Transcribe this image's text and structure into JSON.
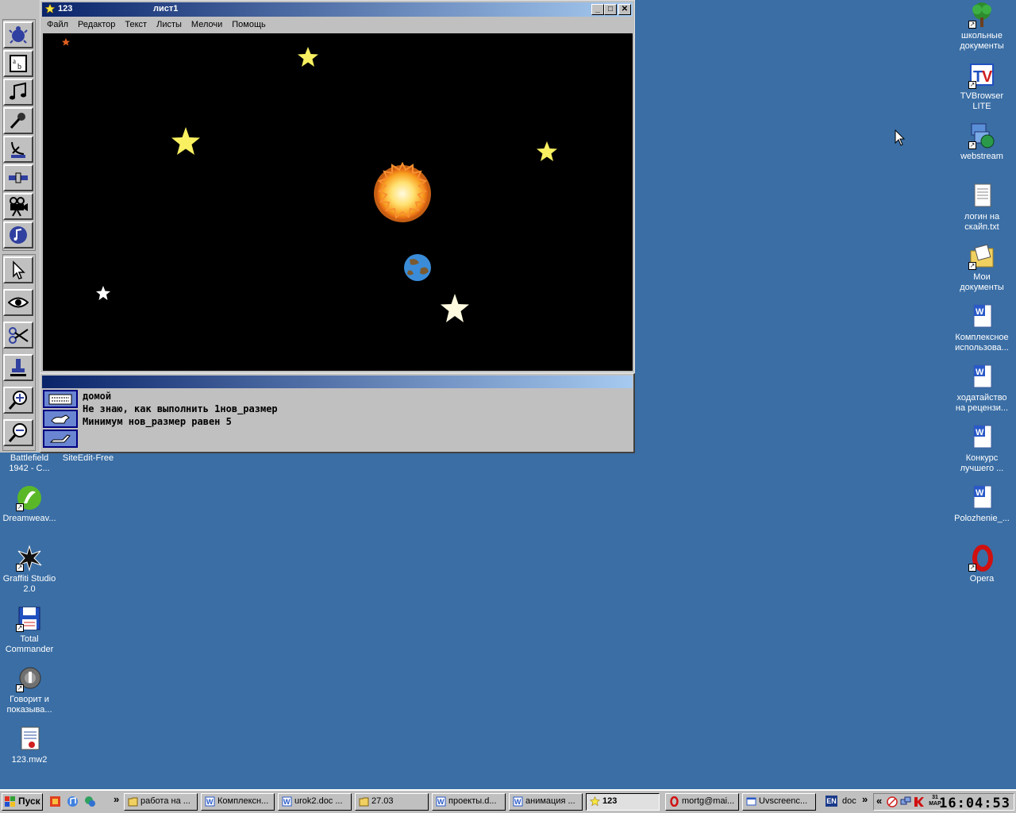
{
  "desktop_icons_right": [
    {
      "label": "школьные документы",
      "icon": "tree-icon"
    },
    {
      "label": "TVBrowser LITE",
      "icon": "tv-icon"
    },
    {
      "label": "webstream",
      "icon": "globe-icon"
    },
    {
      "label": "логин на скайп.txt",
      "icon": "text-file-icon"
    },
    {
      "label": "Мои документы",
      "icon": "folder-icon"
    },
    {
      "label": "Комплексное использова...",
      "icon": "word-doc-icon"
    },
    {
      "label": "ходатайство на рецензи...",
      "icon": "word-doc-icon"
    },
    {
      "label": "Конкурс лучшего ...",
      "icon": "word-doc-icon"
    },
    {
      "label": "Polozhenie_...",
      "icon": "word-doc-icon"
    },
    {
      "label": "Opera",
      "icon": "opera-icon"
    }
  ],
  "desktop_icons_left": [
    {
      "label": "Battlefield 1942 - C...",
      "icon": "game-icon"
    },
    {
      "label": "SiteEdit-Free",
      "icon": "app-icon"
    },
    {
      "label": "Dreamweav...",
      "icon": "dreamweaver-icon"
    },
    {
      "label": "Graffiti Studio 2.0",
      "icon": "graffiti-icon"
    },
    {
      "label": "Total Commander",
      "icon": "floppy-icon"
    },
    {
      "label": "Говорит и показыва...",
      "icon": "media-icon"
    },
    {
      "label": "123.mw2",
      "icon": "document-icon"
    }
  ],
  "window": {
    "app_title": "123",
    "doc_title": "лист1",
    "menu": [
      "Файл",
      "Редактор",
      "Текст",
      "Листы",
      "Мелочи",
      "Помощь"
    ]
  },
  "command_output": [
    "домой",
    "Не знаю, как выполнить 1нов_размер",
    "Минимум нов_размер равен 5"
  ],
  "taskbar": {
    "start_label": "Пуск",
    "buttons": [
      {
        "label": "работа на ...",
        "icon": "folder-icon"
      },
      {
        "label": "Комплексн...",
        "icon": "word-icon"
      },
      {
        "label": "urok2.doc ...",
        "icon": "word-icon"
      },
      {
        "label": "27.03",
        "icon": "folder-icon"
      },
      {
        "label": "проекты.d...",
        "icon": "word-icon"
      },
      {
        "label": "анимация ...",
        "icon": "word-icon"
      },
      {
        "label": "123",
        "icon": "star-icon"
      },
      {
        "label": "mortg@mai...",
        "icon": "opera-icon"
      },
      {
        "label": "Uvscreenc...",
        "icon": "app-icon"
      }
    ],
    "lang": "EN",
    "toolbar_label": "doc",
    "tray_date": "31 МАР",
    "clock": "16:04:53"
  },
  "colors": {
    "desktop": "#3a6ea5",
    "title_active": "#0a246a",
    "canvas": "#000000",
    "star": "#f8f060"
  }
}
